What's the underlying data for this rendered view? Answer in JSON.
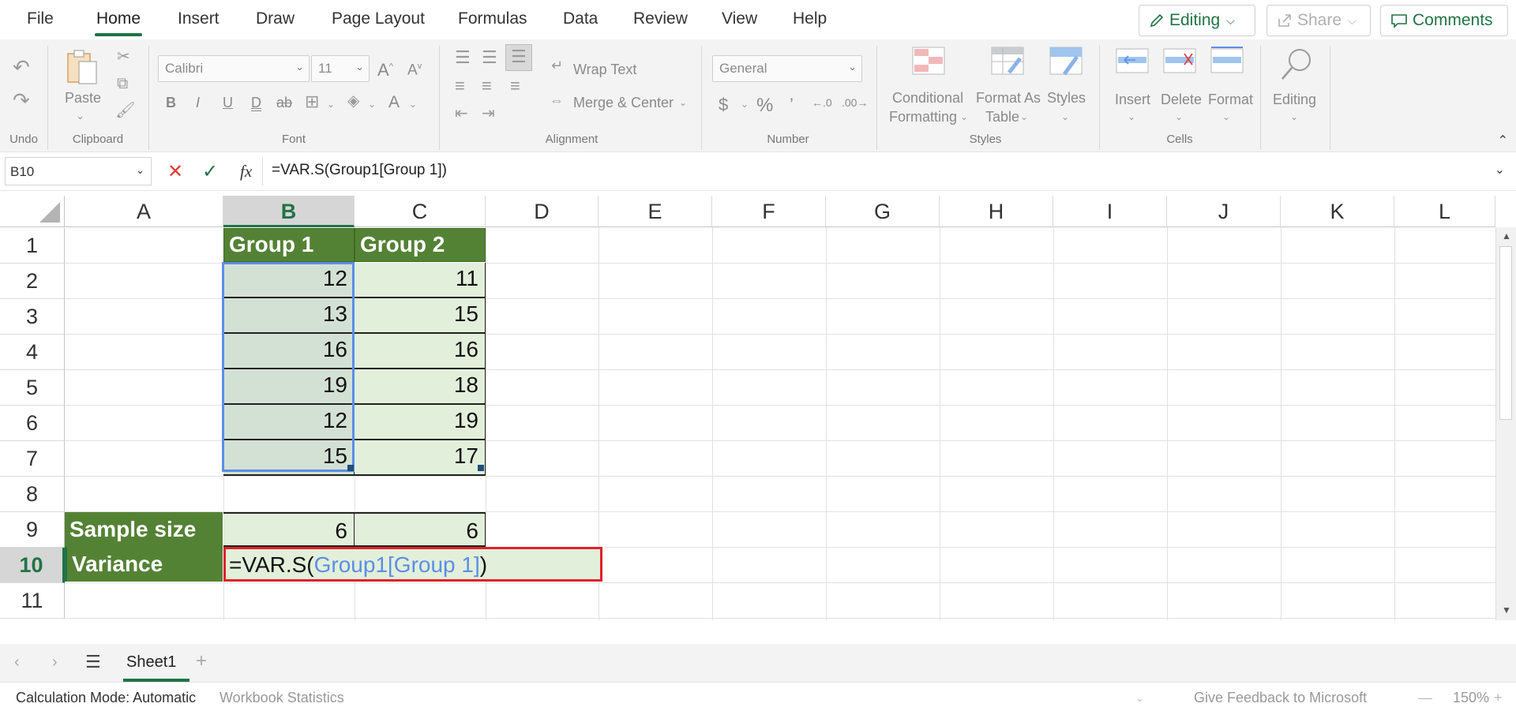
{
  "menu": {
    "tabs": [
      "File",
      "Home",
      "Insert",
      "Draw",
      "Page Layout",
      "Formulas",
      "Data",
      "Review",
      "View",
      "Help"
    ],
    "active": "Home",
    "editing_label": "Editing",
    "share_label": "Share",
    "comments_label": "Comments"
  },
  "ribbon": {
    "groups": {
      "undo": "Undo",
      "clipboard": "Clipboard",
      "font": "Font",
      "alignment": "Alignment",
      "number": "Number",
      "styles": "Styles",
      "cells": "Cells"
    },
    "paste_label": "Paste",
    "font_name": "Calibri",
    "font_size": "11",
    "wrap_text": "Wrap Text",
    "merge_center": "Merge & Center",
    "number_format": "General",
    "conditional_formatting_1": "Conditional",
    "conditional_formatting_2": "Formatting",
    "format_as_table_1": "Format As",
    "format_as_table_2": "Table",
    "styles_label": "Styles",
    "insert_label": "Insert",
    "delete_label": "Delete",
    "format_label": "Format",
    "editing_label": "Editing"
  },
  "formula_bar": {
    "name_box": "B10",
    "formula": "=VAR.S(Group1[Group 1])"
  },
  "grid": {
    "columns": [
      "A",
      "B",
      "C",
      "D",
      "E",
      "F",
      "G",
      "H",
      "I",
      "J",
      "K",
      "L"
    ],
    "rows": [
      "1",
      "2",
      "3",
      "4",
      "5",
      "6",
      "7",
      "8",
      "9",
      "10",
      "11"
    ],
    "selected_column": "B",
    "selected_row": "10",
    "header_group1": "Group 1",
    "header_group2": "Group 2",
    "group1": [
      "12",
      "13",
      "16",
      "19",
      "12",
      "15"
    ],
    "group2": [
      "11",
      "15",
      "16",
      "18",
      "19",
      "17"
    ],
    "sample_size_label": "Sample size",
    "sample_size_b": "6",
    "sample_size_c": "6",
    "variance_label": "Variance",
    "edit_prefix": "=VAR.S(",
    "edit_ref": "Group1[Group 1]",
    "edit_suffix": ")"
  },
  "sheets": {
    "active": "Sheet1",
    "add": "+"
  },
  "status": {
    "calc_mode": "Calculation Mode: Automatic",
    "workbook_stats": "Workbook Statistics",
    "feedback": "Give Feedback to Microsoft",
    "zoom": "150%"
  },
  "colors": {
    "accent": "#217346",
    "header_fill": "#548235",
    "data_fill": "#e2efda",
    "range_ref": "#5b8ee6",
    "edit_border": "#e0202a"
  }
}
